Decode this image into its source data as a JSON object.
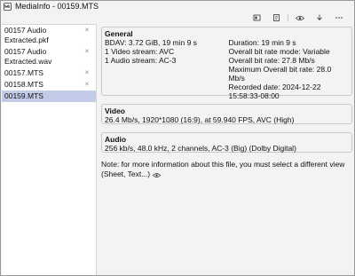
{
  "window": {
    "title": "MediaInfo - 00159.MTS"
  },
  "toolbar": {
    "buttons": [
      {
        "name": "view-sheet-icon"
      },
      {
        "name": "view-text-icon"
      },
      {
        "name": "eye-icon"
      },
      {
        "name": "export-icon"
      },
      {
        "name": "more-icon"
      }
    ]
  },
  "sidebar": {
    "files": [
      {
        "label": "00157 Audio Extracted.pkf",
        "selected": false
      },
      {
        "label": "00157 Audio Extracted.wav",
        "selected": false
      },
      {
        "label": "00157.MTS",
        "selected": false
      },
      {
        "label": "00158.MTS",
        "selected": false
      },
      {
        "label": "00159.MTS",
        "selected": true
      }
    ]
  },
  "general": {
    "title": "General",
    "left": [
      "BDAV: 3.72 GiB, 19 min 9 s",
      "1 Video stream: AVC",
      "1 Audio stream: AC-3"
    ],
    "right": [
      "Duration: 19 min 9 s",
      "Overall bit rate mode: Variable",
      "Overall bit rate: 27.8 Mb/s",
      "Maximum Overall bit rate: 28.0 Mb/s",
      "Recorded date: 2024-12-22",
      "15:58:33-08:00"
    ]
  },
  "video": {
    "title": "Video",
    "text": "26.4 Mb/s, 1920*1080 (16:9), at 59.940 FPS, AVC (High)"
  },
  "audio": {
    "title": "Audio",
    "text": "256 kb/s, 48.0 kHz, 2 channels, AC-3 (Big) (Dolby Digital)"
  },
  "note": {
    "line1": "Note: for more information about this file, you must select a different view",
    "line2": "(Sheet, Text...)"
  }
}
